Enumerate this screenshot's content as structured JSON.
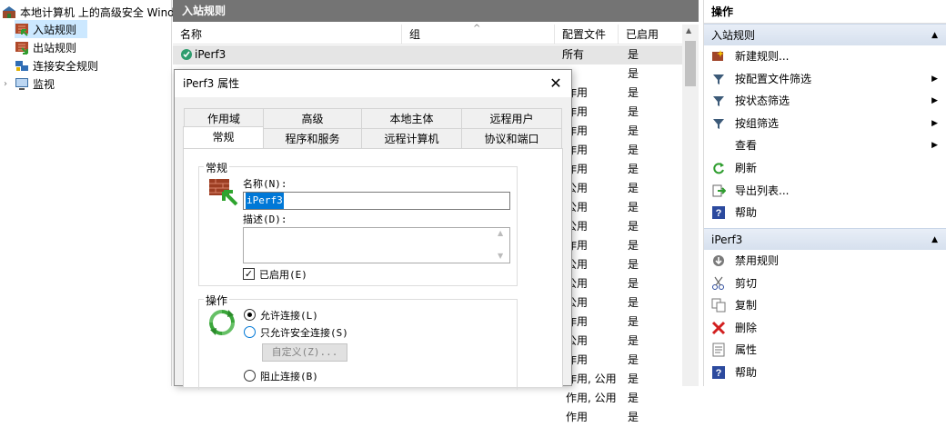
{
  "tree": {
    "root": "本地计算机 上的高级安全 Wind",
    "items": [
      {
        "label": "入站规则",
        "icon": "inbound-rules-icon"
      },
      {
        "label": "出站规则",
        "icon": "outbound-rules-icon"
      },
      {
        "label": "连接安全规则",
        "icon": "connection-security-icon"
      },
      {
        "label": "监视",
        "icon": "monitor-icon"
      }
    ]
  },
  "list": {
    "title": "入站规则",
    "columns": [
      "名称",
      "组",
      "配置文件",
      "已启用"
    ],
    "rows": [
      {
        "name": "iPerf3",
        "group": "",
        "profile": "所有",
        "enabled": "是"
      },
      {
        "profile": "",
        "enabled": "是"
      },
      {
        "profile": "作用",
        "enabled": "是"
      },
      {
        "profile": "作用",
        "enabled": "是"
      },
      {
        "profile": "作用",
        "enabled": "是"
      },
      {
        "profile": "作用",
        "enabled": "是"
      },
      {
        "profile": "作用",
        "enabled": "是"
      },
      {
        "profile": "公用",
        "enabled": "是"
      },
      {
        "profile": "公用",
        "enabled": "是"
      },
      {
        "profile": "公用",
        "enabled": "是"
      },
      {
        "profile": "作用",
        "enabled": "是"
      },
      {
        "profile": "公用",
        "enabled": "是"
      },
      {
        "profile": "公用",
        "enabled": "是"
      },
      {
        "profile": "公用",
        "enabled": "是"
      },
      {
        "profile": "作用",
        "enabled": "是"
      },
      {
        "profile": "公用",
        "enabled": "是"
      },
      {
        "profile": "作用",
        "enabled": "是"
      },
      {
        "profile": "作用, 公用",
        "enabled": "是"
      },
      {
        "profile": "作用, 公用",
        "enabled": "是"
      },
      {
        "profile": "作用",
        "enabled": "是"
      }
    ]
  },
  "actions": {
    "title": "操作",
    "section1": "入站规则",
    "section1_items": [
      {
        "label": "新建规则...",
        "icon": "new-rule-icon",
        "arrow": ""
      },
      {
        "label": "按配置文件筛选",
        "icon": "filter-icon",
        "arrow": "▶"
      },
      {
        "label": "按状态筛选",
        "icon": "filter-icon",
        "arrow": "▶"
      },
      {
        "label": "按组筛选",
        "icon": "filter-icon",
        "arrow": "▶"
      },
      {
        "label": "查看",
        "icon": "",
        "arrow": "▶"
      },
      {
        "label": "刷新",
        "icon": "refresh-icon",
        "arrow": ""
      },
      {
        "label": "导出列表...",
        "icon": "export-icon",
        "arrow": ""
      },
      {
        "label": "帮助",
        "icon": "help-icon",
        "arrow": ""
      }
    ],
    "section2": "iPerf3",
    "section2_items": [
      {
        "label": "禁用规则",
        "icon": "disable-icon"
      },
      {
        "label": "剪切",
        "icon": "cut-icon"
      },
      {
        "label": "复制",
        "icon": "copy-icon"
      },
      {
        "label": "删除",
        "icon": "delete-icon"
      },
      {
        "label": "属性",
        "icon": "properties-icon"
      },
      {
        "label": "帮助",
        "icon": "help-icon"
      }
    ],
    "collapse_glyph": "▲"
  },
  "dialog": {
    "title": "iPerf3 属性",
    "close": "✕",
    "tabs_row1": [
      "作用域",
      "高级",
      "本地主体",
      "远程用户"
    ],
    "tabs_row2": [
      "常规",
      "程序和服务",
      "远程计算机",
      "协议和端口"
    ],
    "general_group": "常规",
    "name_label": "名称(N):",
    "name_value": "iPerf3",
    "desc_label": "描述(D):",
    "enabled_label": "已启用(E)",
    "enabled_checked": true,
    "action_group": "操作",
    "allow_label": "允许连接(L)",
    "allow_secure_label": "只允许安全连接(S)",
    "customize_label": "自定义(Z)...",
    "block_label": "阻止连接(B)",
    "selected_action": "allow"
  },
  "colors": {
    "title_bar": "#747474",
    "selection": "#cce8ff",
    "section_header": "#d6e0ee",
    "accent": "#0078d7"
  }
}
